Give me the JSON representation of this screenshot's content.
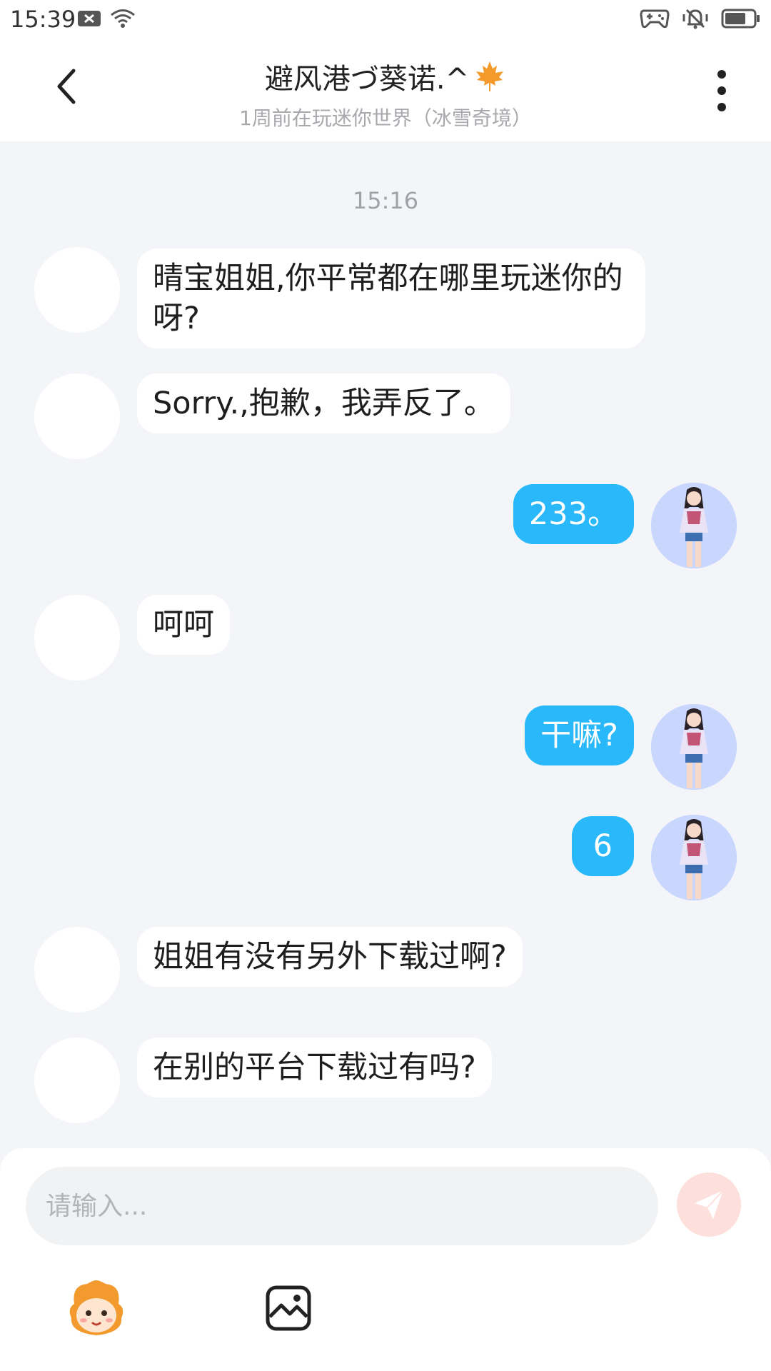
{
  "status_bar": {
    "time": "15:39"
  },
  "header": {
    "title": "避风港づ葵诺.^",
    "subtitle": "1周前在玩迷你世界（冰雪奇境）"
  },
  "chat": {
    "timestamp": "15:16",
    "messages": [
      {
        "side": "other",
        "text": "晴宝姐姐,你平常都在哪里玩迷你的呀?"
      },
      {
        "side": "other",
        "text": "Sorry.,抱歉，我弄反了。"
      },
      {
        "side": "me",
        "text": "233。"
      },
      {
        "side": "other",
        "text": "呵呵"
      },
      {
        "side": "me",
        "text": "干嘛?"
      },
      {
        "side": "me",
        "text": "6"
      },
      {
        "side": "other",
        "text": "姐姐有没有另外下载过啊?"
      },
      {
        "side": "other",
        "text": "在别的平台下载过有吗?"
      }
    ]
  },
  "input": {
    "placeholder": "请输入..."
  },
  "colors": {
    "my_bubble": "#29b9fb",
    "send_button": "#fde0dc",
    "background": "#f4f5f9"
  },
  "icons": {
    "back": "chevron-left-icon",
    "more": "more-vertical-icon",
    "send": "send-plane-icon",
    "emoji": "cartoon-face-icon",
    "image": "image-icon",
    "maple": "maple-leaf-icon"
  }
}
